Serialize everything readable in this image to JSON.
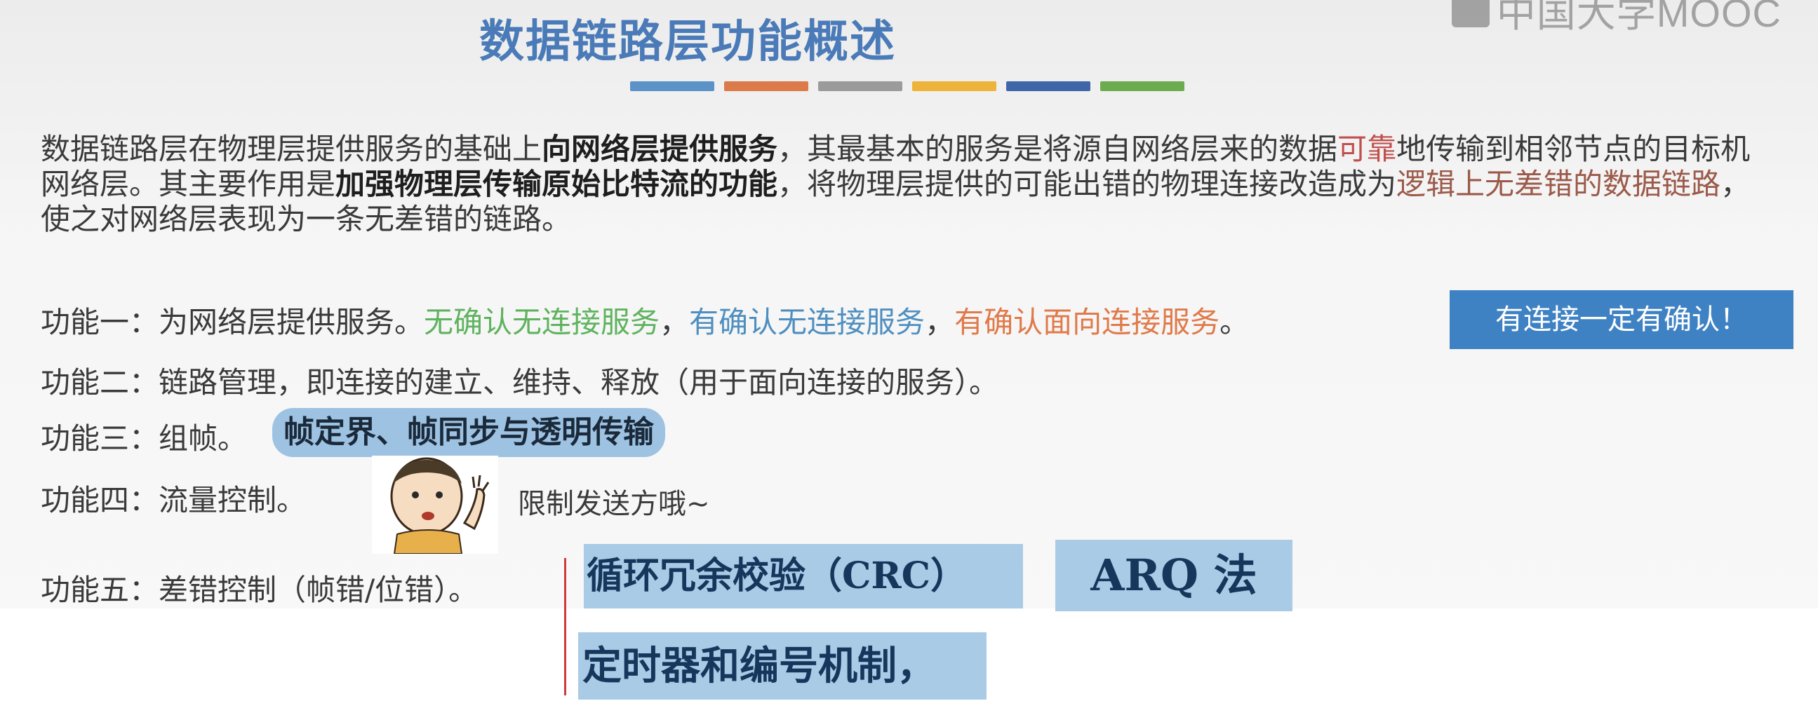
{
  "watermark": {
    "text": "中国大学MOOC"
  },
  "title": "数据链路层功能概述",
  "title_bar_colors": [
    "#5b93c9",
    "#dd7a4a",
    "#9b9b9b",
    "#eeb33a",
    "#3f66a8",
    "#6cac4f"
  ],
  "intro": {
    "p1": "数据链路层在物理层提供服务的基础上",
    "p2": "向网络层提供服务",
    "p3": "，其最基本的服务是将源自网络层来的数据",
    "p4": "可靠",
    "p5": "地传输到相邻节点的目标机网络层。其主要作用是",
    "p6": "加强物理层传输原始比特流的功能",
    "p7": "，将物理层提供的可能出错的物理连接改造成为",
    "p8": "逻辑上无差错的数据链路",
    "p9": "，使之对网络层表现为一条无差错的链路。"
  },
  "func1": {
    "prefix": "功能一：为网络层提供服务。",
    "s1": "无确认无连接服务",
    "sep1": "，",
    "s2": "有确认无连接服务",
    "sep2": "，",
    "s3": "有确认面向连接服务",
    "end": "。",
    "note": "有连接一定有确认！"
  },
  "func2": {
    "text": "功能二：链路管理，即连接的建立、维持、释放（用于面向连接的服务）。"
  },
  "func3": {
    "prefix": "功能三：组帧。",
    "highlight": "帧定界、帧同步与透明传输"
  },
  "func4": {
    "prefix": "功能四：流量控制。",
    "aside": "限制发送方哦~"
  },
  "func5": {
    "prefix": "功能五：差错控制（帧错/位错）。",
    "crc": "循环冗余校验（CRC）",
    "arq": "ARQ 法",
    "timer": "定时器和编号机制，"
  }
}
